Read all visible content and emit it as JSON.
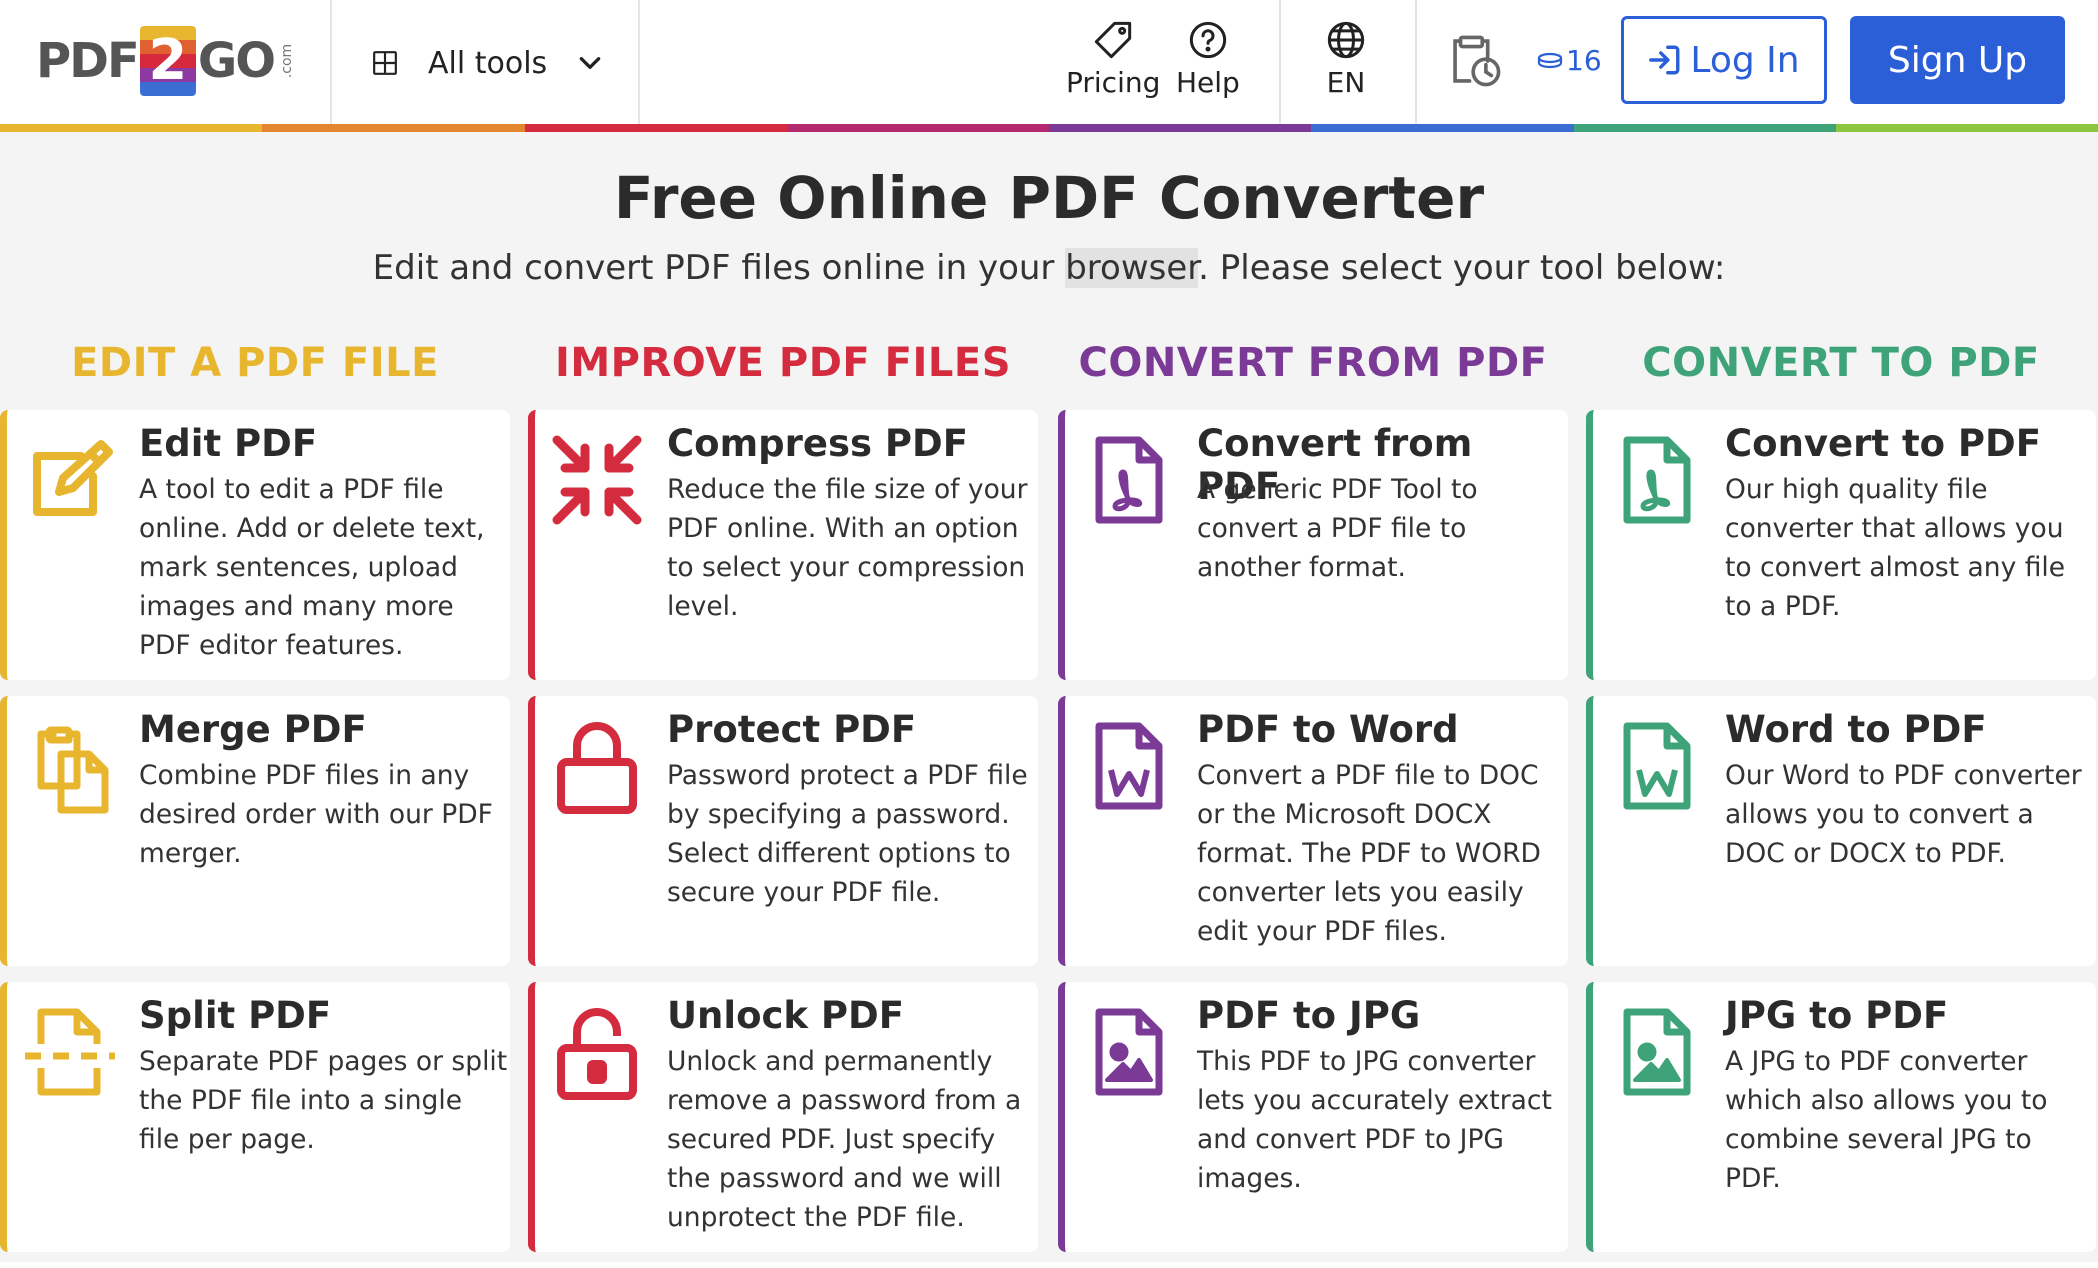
{
  "header": {
    "logo_pre": "PDF",
    "logo_two": "2",
    "logo_post": "GO",
    "logo_com": ".com",
    "all_tools": "All tools",
    "pricing": "Pricing",
    "help": "Help",
    "language": "EN",
    "credits": "16",
    "login": "Log In",
    "signup": "Sign Up"
  },
  "hero": {
    "title": "Free Online PDF Converter",
    "subtitle_pre": "Edit and convert PDF files online in your ",
    "subtitle_hl": "browser",
    "subtitle_post": ". Please select your tool below:"
  },
  "colors": {
    "edit": "#e8b62e",
    "improve": "#d42b3e",
    "convert_from": "#7a3a96",
    "convert_to": "#3fa37a",
    "brand_blue": "#2a5fd8"
  },
  "rainbow": [
    "#e8b62e",
    "#e2862f",
    "#d42b3e",
    "#b32a6e",
    "#7a3a96",
    "#3b6ed3",
    "#3fa37a",
    "#8cc540"
  ],
  "columns": [
    {
      "heading": "EDIT A PDF FILE",
      "cards": [
        {
          "title": "Edit PDF",
          "desc": "A tool to edit a PDF file online. Add or delete text, mark sentences, upload images and many more PDF editor features.",
          "icon": "edit-icon"
        },
        {
          "title": "Merge PDF",
          "desc": "Combine PDF files in any desired order with our PDF merger.",
          "icon": "merge-icon"
        },
        {
          "title": "Split PDF",
          "desc": "Separate PDF pages or split the PDF file into a single file per page.",
          "icon": "split-icon"
        }
      ]
    },
    {
      "heading": "IMPROVE PDF FILES",
      "cards": [
        {
          "title": "Compress PDF",
          "desc": "Reduce the file size of your PDF online. With an option to select your compression level.",
          "icon": "compress-icon"
        },
        {
          "title": "Protect PDF",
          "desc": "Password protect a PDF file by specifying a password. Select different options to secure your PDF file.",
          "icon": "lock-icon"
        },
        {
          "title": "Unlock PDF",
          "desc": "Unlock and permanently remove a password from a secured PDF. Just specify the password and we will unprotect the PDF file.",
          "icon": "unlock-icon"
        }
      ]
    },
    {
      "heading": "CONVERT FROM PDF",
      "cards": [
        {
          "title": "Convert from PDF",
          "desc": "A generic PDF Tool to convert a PDF file to another format.",
          "icon": "pdf-file-icon"
        },
        {
          "title": "PDF to Word",
          "desc": "Convert a PDF file to DOC or the Microsoft DOCX format. The PDF to WORD converter lets you easily edit your PDF files.",
          "icon": "word-file-icon"
        },
        {
          "title": "PDF to JPG",
          "desc": "This PDF to JPG converter lets you accurately extract and convert PDF to JPG images.",
          "icon": "image-file-icon"
        }
      ]
    },
    {
      "heading": "CONVERT TO PDF",
      "cards": [
        {
          "title": "Convert to PDF",
          "desc": "Our high quality file converter that allows you to convert almost any file to a PDF.",
          "icon": "pdf-file-icon"
        },
        {
          "title": "Word to PDF",
          "desc": "Our Word to PDF converter allows you to convert a DOC or DOCX to PDF.",
          "icon": "word-file-icon"
        },
        {
          "title": "JPG to PDF",
          "desc": "A JPG to PDF converter which also allows you to combine several JPG to PDF.",
          "icon": "image-file-icon"
        }
      ]
    }
  ]
}
